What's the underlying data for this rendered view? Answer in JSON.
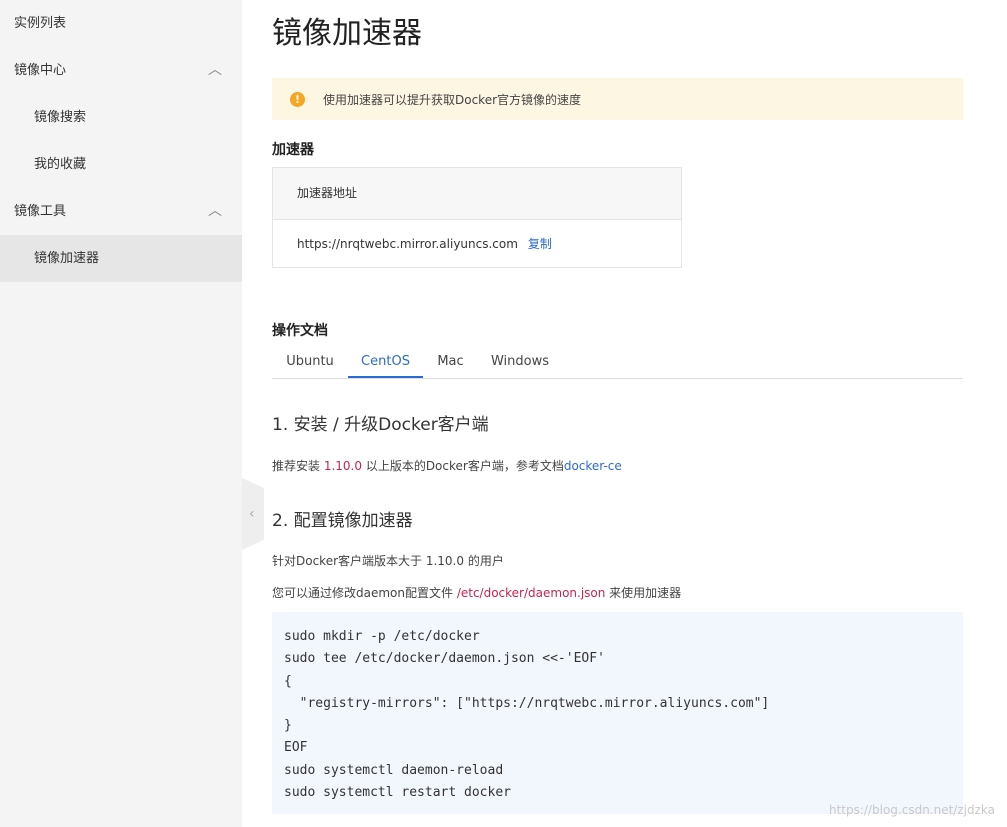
{
  "sidebar": {
    "items": [
      {
        "label": "实例列表"
      },
      {
        "label": "镜像中心",
        "chevron": "chevron-up-icon"
      },
      {
        "label": "镜像搜索"
      },
      {
        "label": "我的收藏"
      },
      {
        "label": "镜像工具",
        "chevron": "chevron-up-icon"
      },
      {
        "label": "镜像加速器"
      }
    ],
    "chevron_glyph": "︿",
    "collapse_glyph": "‹"
  },
  "page": {
    "title": "镜像加速器",
    "alert": {
      "icon": "!",
      "text": "使用加速器可以提升获取Docker官方镜像的速度"
    },
    "accelerator": {
      "section_title": "加速器",
      "column_header": "加速器地址",
      "address": "https://nrqtwebc.mirror.aliyuncs.com",
      "copy_label": "复制"
    },
    "docs": {
      "section_title": "操作文档",
      "tabs": [
        {
          "label": "Ubuntu"
        },
        {
          "label": "CentOS",
          "active": true
        },
        {
          "label": "Mac"
        },
        {
          "label": "Windows"
        }
      ],
      "step1": {
        "title": "1. 安装 / 升级Docker客户端",
        "text_before": "推荐安装 ",
        "version": "1.10.0",
        "text_middle": " 以上版本的Docker客户端，参考文档",
        "link": "docker-ce"
      },
      "step2": {
        "title": "2. 配置镜像加速器",
        "line1": "针对Docker客户端版本大于 1.10.0 的用户",
        "line2_before": "您可以通过修改daemon配置文件 ",
        "config_path": "/etc/docker/daemon.json",
        "line2_after": " 来使用加速器",
        "code": "sudo mkdir -p /etc/docker\nsudo tee /etc/docker/daemon.json <<-'EOF'\n{\n  \"registry-mirrors\": [\"https://nrqtwebc.mirror.aliyuncs.com\"]\n}\nEOF\nsudo systemctl daemon-reload\nsudo systemctl restart docker"
      }
    },
    "watermark": "https://blog.csdn.net/zjdzka"
  },
  "colors": {
    "accent": "#2a6ad2",
    "alert_bg": "#fdf6e3",
    "alert_icon": "#f5a623",
    "code_bg": "#f2f7fd",
    "highlight_red": "#c7254e"
  }
}
